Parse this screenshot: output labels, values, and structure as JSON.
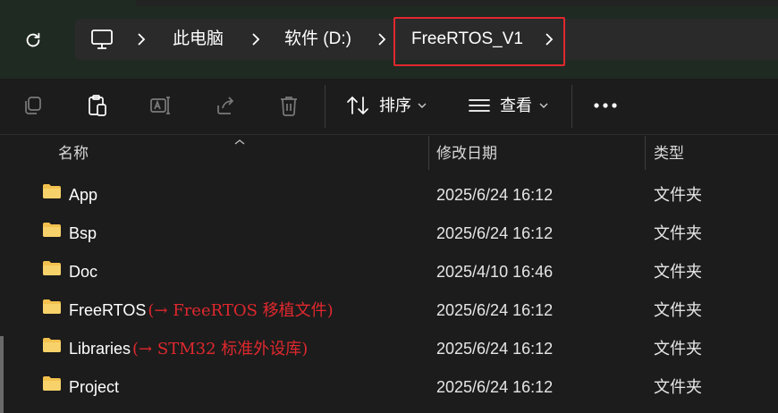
{
  "address_bar": {
    "breadcrumbs": [
      "此电脑",
      "软件 (D:)",
      "FreeRTOS_V1"
    ],
    "icons": {
      "refresh": "refresh-icon",
      "root": "computer-icon",
      "separator": "chevron-right-icon"
    }
  },
  "toolbar": {
    "sort_label": "排序",
    "view_label": "查看",
    "icons": [
      "copy-icon",
      "paste-icon",
      "rename-icon",
      "share-icon",
      "delete-icon",
      "sort-icon",
      "view-icon",
      "more-icon"
    ]
  },
  "columns": {
    "name": "名称",
    "modified": "修改日期",
    "type": "类型"
  },
  "files": [
    {
      "name": "App",
      "note": "",
      "modified": "2025/6/24 16:12",
      "type": "文件夹"
    },
    {
      "name": "Bsp",
      "note": "",
      "modified": "2025/6/24 16:12",
      "type": "文件夹"
    },
    {
      "name": "Doc",
      "note": "",
      "modified": "2025/4/10 16:46",
      "type": "文件夹"
    },
    {
      "name": "FreeRTOS",
      "note": "(→ FreeRTOS 移植文件)",
      "modified": "2025/6/24 16:12",
      "type": "文件夹"
    },
    {
      "name": "Libraries",
      "note": "(→ STM32 标准外设库)",
      "modified": "2025/6/24 16:12",
      "type": "文件夹"
    },
    {
      "name": "Project",
      "note": "",
      "modified": "2025/6/24 16:12",
      "type": "文件夹"
    }
  ],
  "colors": {
    "highlight": "#e0282e",
    "annotation": "#e0282e",
    "folder": "#f2c14e",
    "background": "#1c1c1c"
  }
}
